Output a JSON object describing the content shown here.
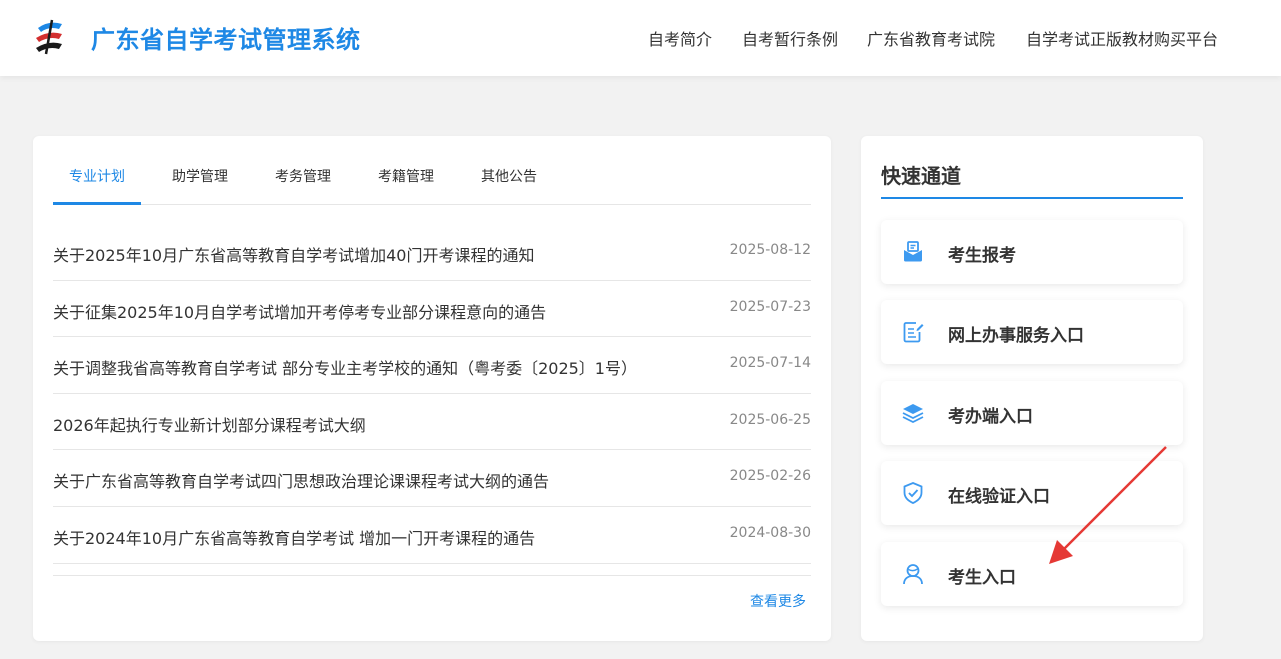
{
  "header": {
    "site_title": "广东省自学考试管理系统",
    "nav": [
      "自考简介",
      "自考暂行条例",
      "广东省教育考试院",
      "自学考试正版教材购买平台"
    ]
  },
  "news": {
    "tabs": [
      "专业计划",
      "助学管理",
      "考务管理",
      "考籍管理",
      "其他公告"
    ],
    "active_tab": "专业计划",
    "items": [
      {
        "title": "关于2025年10月广东省高等教育自学考试增加40门开考课程的通知",
        "date": "2025-08-12"
      },
      {
        "title": "关于征集2025年10月自学考试增加开考停考专业部分课程意向的通告",
        "date": "2025-07-23"
      },
      {
        "title": "关于调整我省高等教育自学考试 部分专业主考学校的通知（粤考委〔2025〕1号）",
        "date": "2025-07-14"
      },
      {
        "title": "2026年起执行专业新计划部分课程考试大纲",
        "date": "2025-06-25"
      },
      {
        "title": "关于广东省高等教育自学考试四门思想政治理论课课程考试大纲的通告",
        "date": "2025-02-26"
      },
      {
        "title": "关于2024年10月广东省高等教育自学考试 增加一门开考课程的通告",
        "date": "2024-08-30"
      }
    ],
    "more_label": "查看更多"
  },
  "quick": {
    "title": "快速通道",
    "items": [
      {
        "label": "考生报考",
        "icon": "mailbox-icon"
      },
      {
        "label": "网上办事服务入口",
        "icon": "document-edit-icon"
      },
      {
        "label": "考办端入口",
        "icon": "layers-icon"
      },
      {
        "label": "在线验证入口",
        "icon": "shield-check-icon"
      },
      {
        "label": "考生入口",
        "icon": "user-icon"
      }
    ]
  },
  "colors": {
    "accent": "#1e88e5",
    "icon": "#3d9af0",
    "annotation_arrow": "#e53935"
  }
}
